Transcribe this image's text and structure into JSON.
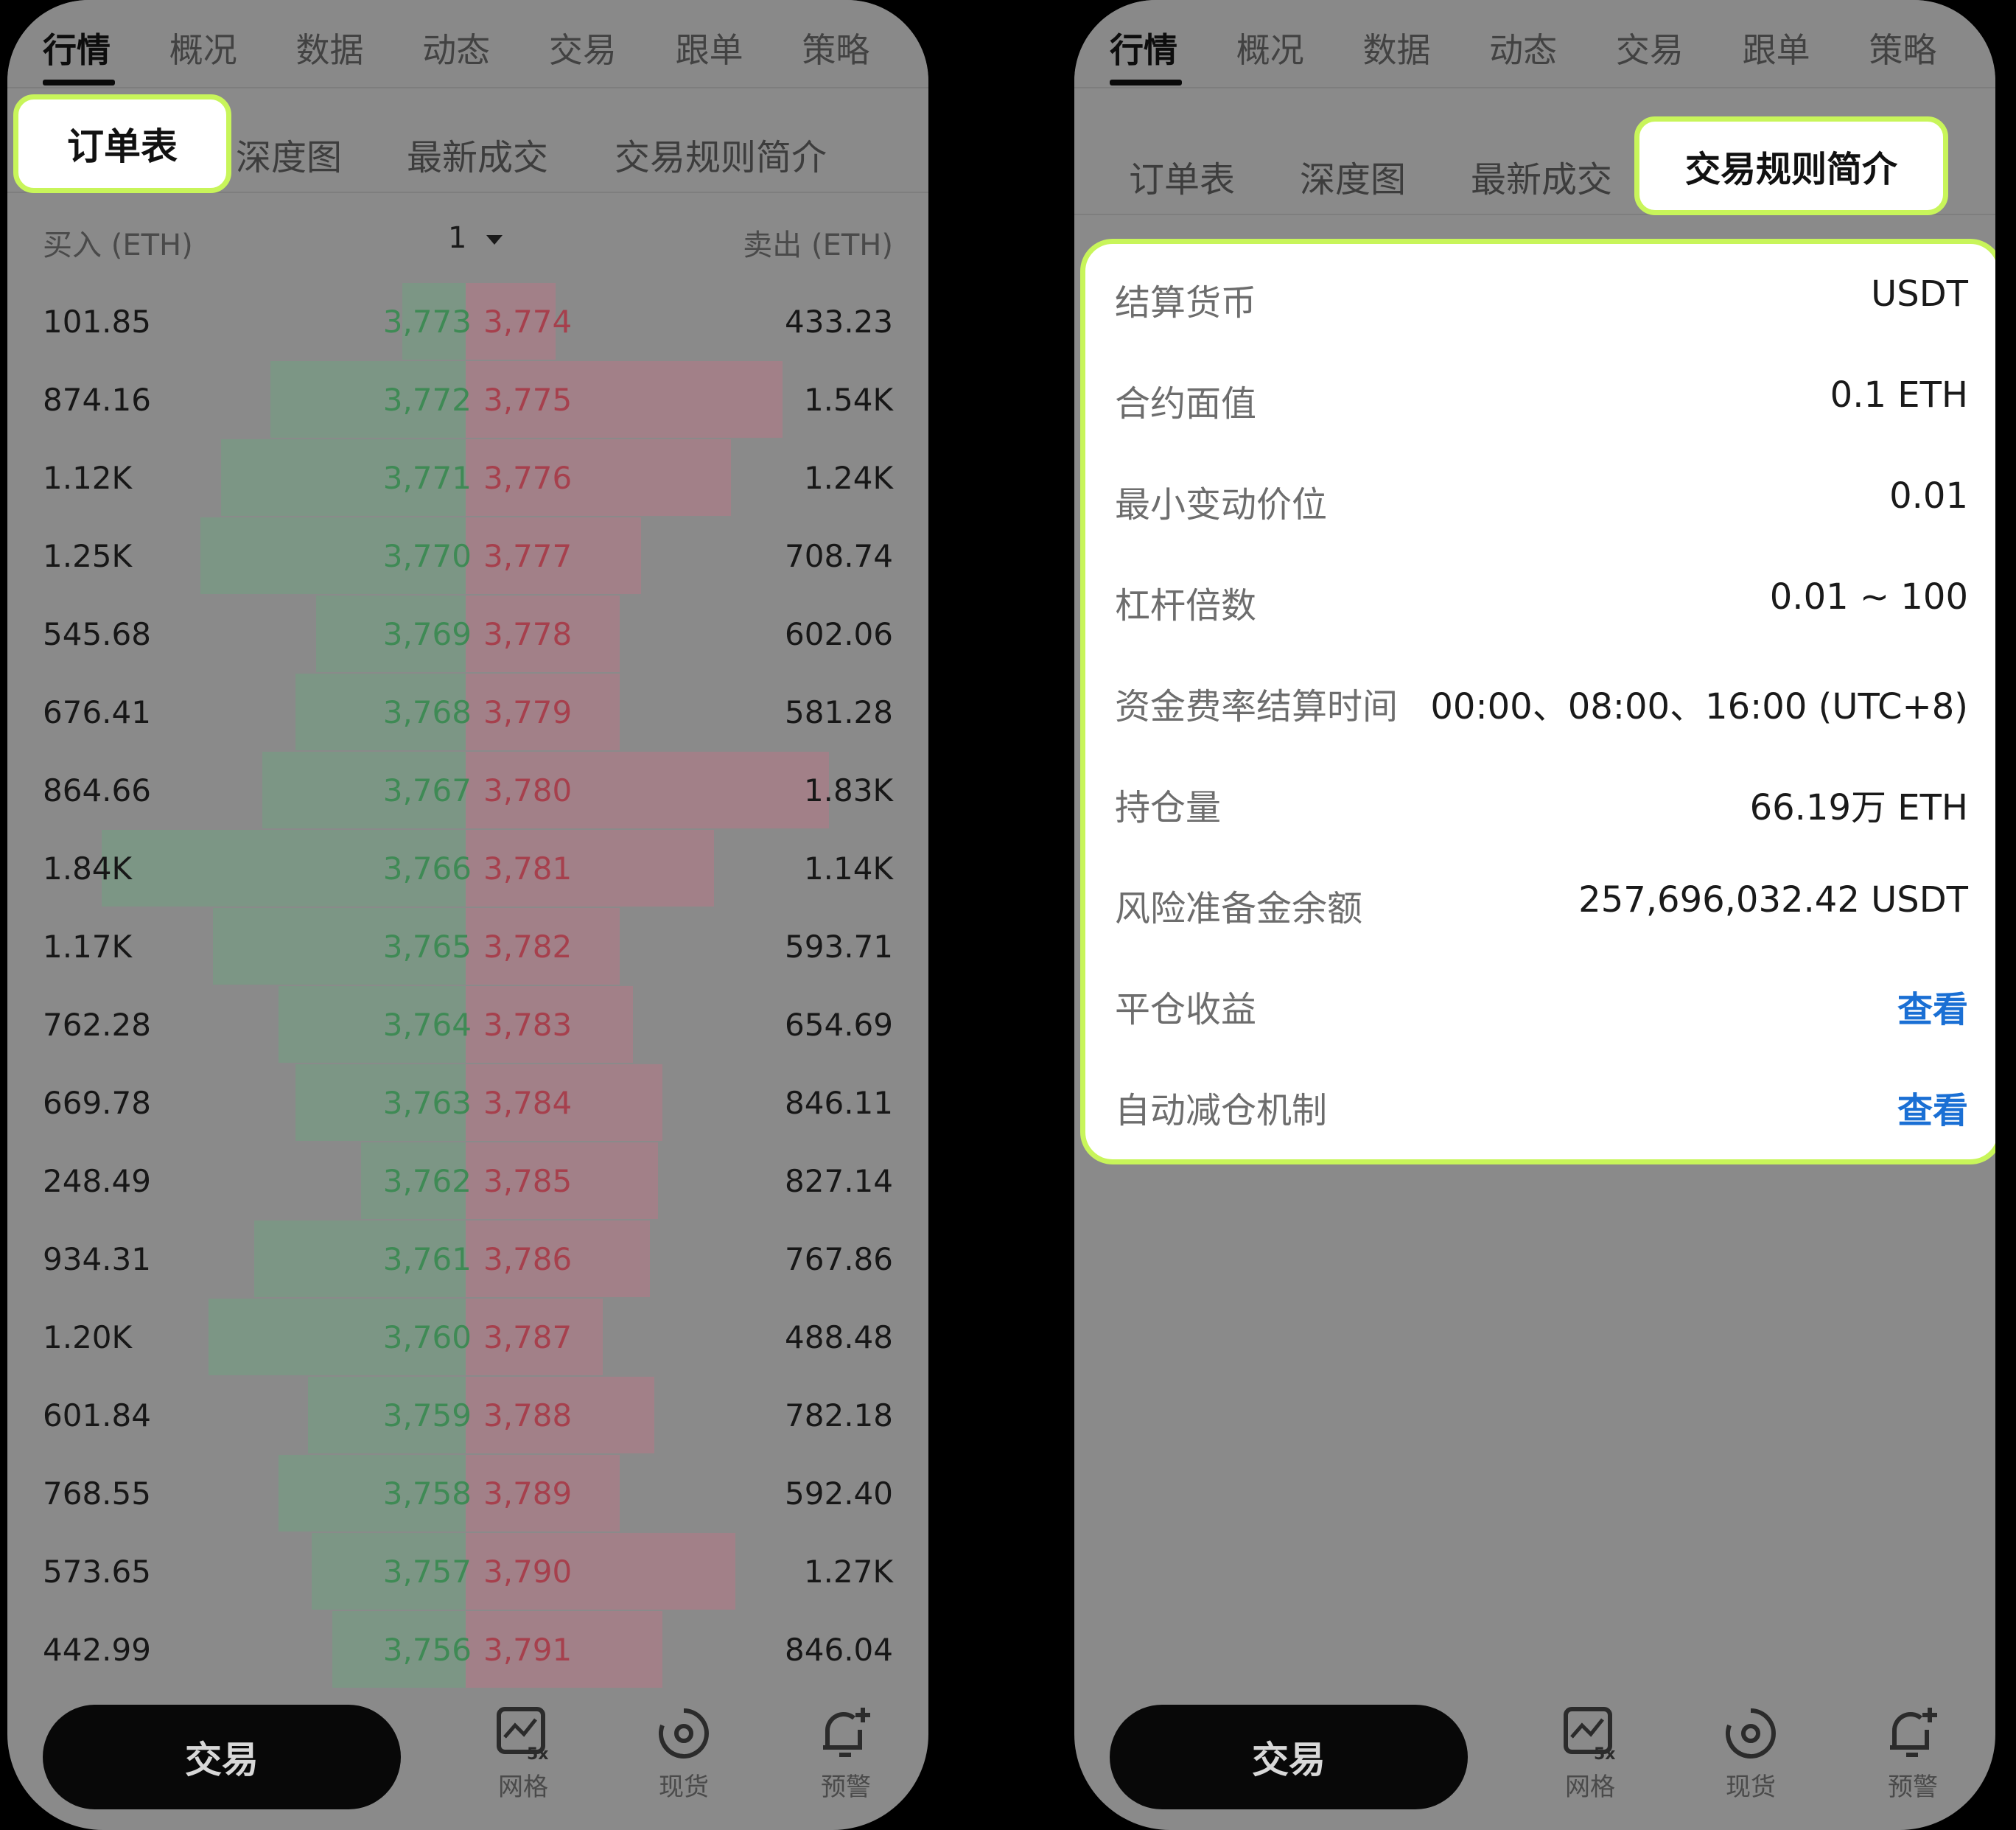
{
  "top_tabs": [
    "行情",
    "概况",
    "数据",
    "动态",
    "交易",
    "跟单",
    "策略"
  ],
  "top_tabs_visible": [
    "行情",
    "概况",
    "数据",
    "动态",
    "交易",
    "跟单",
    "策略"
  ],
  "sub_tabs": [
    "订单表",
    "深度图",
    "最新成交",
    "交易规则简介"
  ],
  "order_book": {
    "buy_header": "买入 (ETH)",
    "depth_selector": "1",
    "sell_header": "卖出 (ETH)",
    "rows": [
      {
        "bid_qty": "101.85",
        "bid_px": "3,773",
        "ask_px": "3,774",
        "ask_qty": "433.23",
        "bid_depth": 0.01,
        "ask_depth": 0.09
      },
      {
        "bid_qty": "874.16",
        "bid_px": "3,772",
        "ask_px": "3,775",
        "ask_qty": "1.54K",
        "bid_depth": 0.33,
        "ask_depth": 0.62
      },
      {
        "bid_qty": "1.12K",
        "bid_px": "3,771",
        "ask_px": "3,776",
        "ask_qty": "1.24K",
        "bid_depth": 0.45,
        "ask_depth": 0.5
      },
      {
        "bid_qty": "1.25K",
        "bid_px": "3,770",
        "ask_px": "3,777",
        "ask_qty": "708.74",
        "bid_depth": 0.5,
        "ask_depth": 0.29
      },
      {
        "bid_qty": "545.68",
        "bid_px": "3,769",
        "ask_px": "3,778",
        "ask_qty": "602.06",
        "bid_depth": 0.22,
        "ask_depth": 0.24
      },
      {
        "bid_qty": "676.41",
        "bid_px": "3,768",
        "ask_px": "3,779",
        "ask_qty": "581.28",
        "bid_depth": 0.27,
        "ask_depth": 0.24
      },
      {
        "bid_qty": "864.66",
        "bid_px": "3,767",
        "ask_px": "3,780",
        "ask_qty": "1.83K",
        "bid_depth": 0.35,
        "ask_depth": 0.73
      },
      {
        "bid_qty": "1.84K",
        "bid_px": "3,766",
        "ask_px": "3,781",
        "ask_qty": "1.14K",
        "bid_depth": 0.74,
        "ask_depth": 0.46
      },
      {
        "bid_qty": "1.17K",
        "bid_px": "3,765",
        "ask_px": "3,782",
        "ask_qty": "593.71",
        "bid_depth": 0.47,
        "ask_depth": 0.24
      },
      {
        "bid_qty": "762.28",
        "bid_px": "3,764",
        "ask_px": "3,783",
        "ask_qty": "654.69",
        "bid_depth": 0.31,
        "ask_depth": 0.27
      },
      {
        "bid_qty": "669.78",
        "bid_px": "3,763",
        "ask_px": "3,784",
        "ask_qty": "846.11",
        "bid_depth": 0.27,
        "ask_depth": 0.34
      },
      {
        "bid_qty": "248.49",
        "bid_px": "3,762",
        "ask_px": "3,785",
        "ask_qty": "827.14",
        "bid_depth": 0.11,
        "ask_depth": 0.33
      },
      {
        "bid_qty": "934.31",
        "bid_px": "3,761",
        "ask_px": "3,786",
        "ask_qty": "767.86",
        "bid_depth": 0.37,
        "ask_depth": 0.31
      },
      {
        "bid_qty": "1.20K",
        "bid_px": "3,760",
        "ask_px": "3,787",
        "ask_qty": "488.48",
        "bid_depth": 0.48,
        "ask_depth": 0.2
      },
      {
        "bid_qty": "601.84",
        "bid_px": "3,759",
        "ask_px": "3,788",
        "ask_qty": "782.18",
        "bid_depth": 0.24,
        "ask_depth": 0.32
      },
      {
        "bid_qty": "768.55",
        "bid_px": "3,758",
        "ask_px": "3,789",
        "ask_qty": "592.40",
        "bid_depth": 0.31,
        "ask_depth": 0.24
      },
      {
        "bid_qty": "573.65",
        "bid_px": "3,757",
        "ask_px": "3,790",
        "ask_qty": "1.27K",
        "bid_depth": 0.23,
        "ask_depth": 0.51
      },
      {
        "bid_qty": "442.99",
        "bid_px": "3,756",
        "ask_px": "3,791",
        "ask_qty": "846.04",
        "bid_depth": 0.18,
        "ask_depth": 0.34
      }
    ]
  },
  "rules": [
    {
      "label": "结算货币",
      "value": "USDT",
      "link": false
    },
    {
      "label": "合约面值",
      "value": "0.1 ETH",
      "link": false
    },
    {
      "label": "最小变动价位",
      "value": "0.01",
      "link": false
    },
    {
      "label": "杠杆倍数",
      "value": "0.01 ~ 100",
      "link": false
    },
    {
      "label": "资金费率结算时间",
      "value": "00:00、08:00、16:00 (UTC+8)",
      "link": false
    },
    {
      "label": "持仓量",
      "value": "66.19万 ETH",
      "link": false
    },
    {
      "label": "风险准备金余额",
      "value": "257,696,032.42 USDT",
      "link": false
    },
    {
      "label": "平仓收益",
      "value": "查看",
      "link": true
    },
    {
      "label": "自动减仓机制",
      "value": "查看",
      "link": true
    }
  ],
  "bottom_nav": {
    "trade_label": "交易",
    "items": [
      {
        "label": "网格",
        "icon": "grid-chart-icon",
        "badge": "5x"
      },
      {
        "label": "现货",
        "icon": "spot-icon"
      },
      {
        "label": "预警",
        "icon": "alert-bell-icon"
      }
    ]
  },
  "colors": {
    "highlight": "#c8f55a",
    "bid": "#3f8a55",
    "ask": "#a6404d",
    "link": "#1a6fd4"
  }
}
